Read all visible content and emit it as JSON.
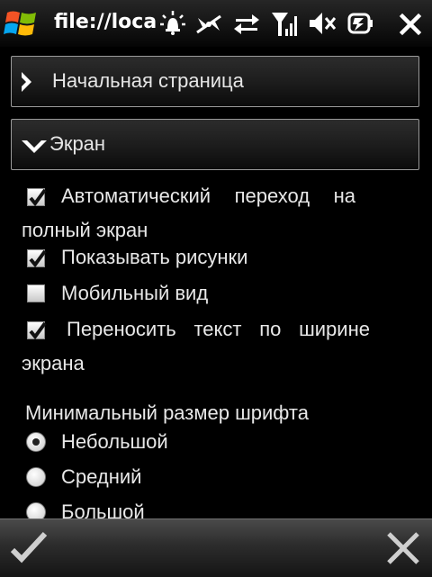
{
  "statusbar": {
    "title": "file://loca",
    "icons": [
      "windows-start-icon",
      "notification-icon",
      "wireless-icon",
      "data-transfer-icon",
      "signal-strength-icon",
      "volume-muted-icon",
      "battery-icon",
      "close-icon"
    ]
  },
  "sections": [
    {
      "label": "Начальная страница",
      "state": "collapsed"
    },
    {
      "label": "Экран",
      "state": "expanded"
    }
  ],
  "options": {
    "auto_fullscreen": {
      "line1_words": [
        "Автоматический",
        "переход",
        "на"
      ],
      "line2": "полный экран",
      "checked": true
    },
    "show_images": {
      "label": "Показывать рисунки",
      "checked": true
    },
    "mobile_view": {
      "label": "Мобильный вид",
      "checked": false
    },
    "wrap_text": {
      "line1_words": [
        "Переносить",
        "текст",
        "по",
        "ширине"
      ],
      "line2": "экрана",
      "checked": true
    }
  },
  "font_size": {
    "heading": "Минимальный размер шрифта",
    "choices": [
      {
        "label": "Небольшой",
        "selected": true
      },
      {
        "label": "Средний",
        "selected": false
      },
      {
        "label": "Большой",
        "selected": false
      }
    ]
  },
  "softkeys": {
    "ok": "checkmark-icon",
    "cancel": "close-icon"
  }
}
